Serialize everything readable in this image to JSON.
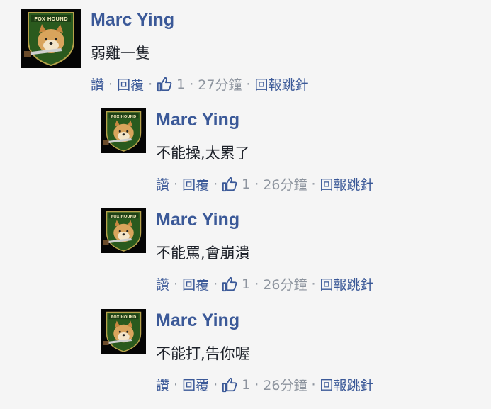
{
  "comments": [
    {
      "author": "Marc Ying",
      "text": "弱雞一隻",
      "actions": {
        "like": "讚",
        "reply": "回覆",
        "like_count": "1",
        "time": "27分鐘",
        "report": "回報跳針"
      }
    },
    {
      "author": "Marc Ying",
      "text": "不能操,太累了",
      "actions": {
        "like": "讚",
        "reply": "回覆",
        "like_count": "1",
        "time": "26分鐘",
        "report": "回報跳針"
      }
    },
    {
      "author": "Marc Ying",
      "text": "不能罵,會崩潰",
      "actions": {
        "like": "讚",
        "reply": "回覆",
        "like_count": "1",
        "time": "26分鐘",
        "report": "回報跳針"
      }
    },
    {
      "author": "Marc Ying",
      "text": "不能打,告你喔",
      "actions": {
        "like": "讚",
        "reply": "回覆",
        "like_count": "1",
        "time": "26分鐘",
        "report": "回報跳針"
      }
    }
  ],
  "avatar_logo_text": "FOX HOUND",
  "colors": {
    "link": "#3b5998",
    "meta": "#8d949e",
    "text": "#1d2129",
    "background": "#f5f5f5"
  },
  "icons": {
    "like": "thumbs-up-icon",
    "avatar": "fox-hound-shiba-avatar"
  }
}
